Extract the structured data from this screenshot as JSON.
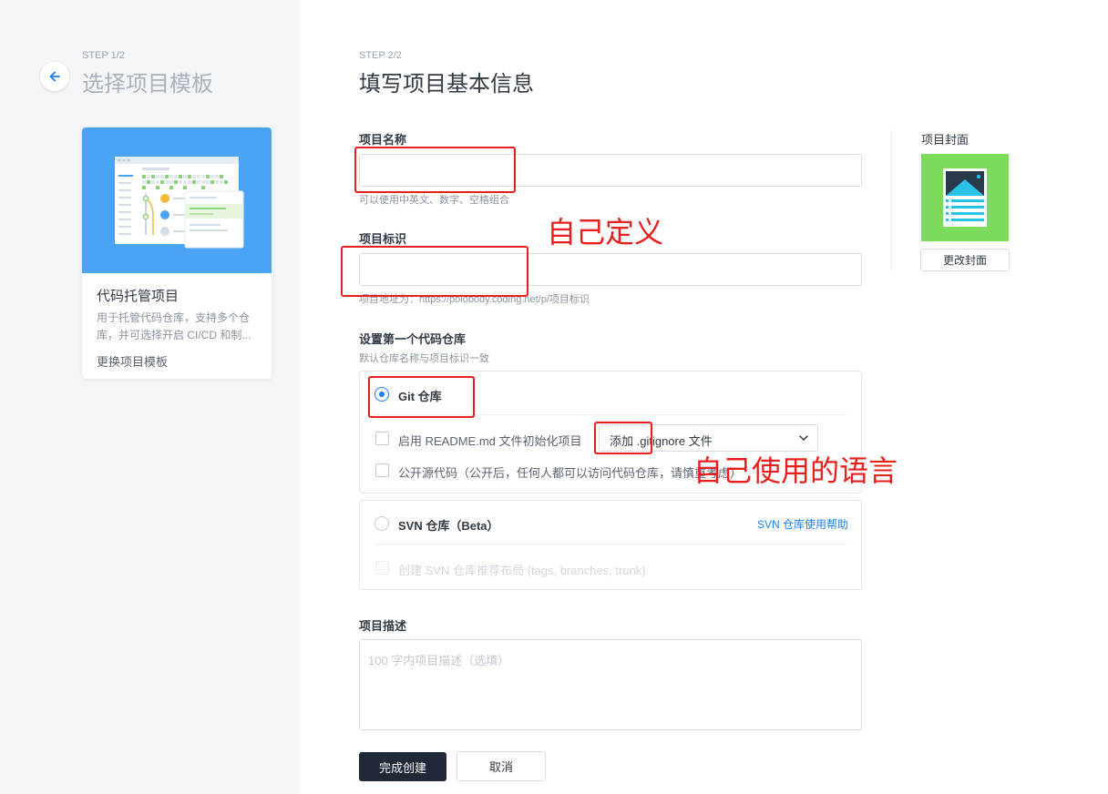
{
  "left_panel": {
    "step_label": "STEP 1/2",
    "title": "选择项目模板",
    "template": {
      "name": "代码托管项目",
      "description": "用于托管代码仓库，支持多个仓库，并可选择开启 CI/CD 和制...",
      "change_link": "更换项目模板"
    }
  },
  "main": {
    "step_label": "STEP 2/2",
    "title": "填写项目基本信息",
    "project_name": {
      "label": "项目名称",
      "value": "",
      "hint": "可以使用中英文、数字、空格组合"
    },
    "project_id": {
      "label": "项目标识",
      "value": "",
      "hint": "项目地址为：https://polobody.coding.net/p/项目标识"
    },
    "repo_section": {
      "label": "设置第一个代码仓库",
      "hint": "默认仓库名称与项目标识一致",
      "git": {
        "title": "Git 仓库",
        "selected": true,
        "readme_option": "启用 README.md 文件初始化项目",
        "gitignore_select": "添加 .gitignore 文件",
        "public_option": "公开源代码（公开后，任何人都可以访问代码仓库，请慎重考虑）"
      },
      "svn": {
        "title": "SVN 仓库（Beta）",
        "selected": false,
        "help_link": "SVN 仓库使用帮助",
        "layout_option": "创建 SVN 仓库推荐布局 (tags, branches, trunk)"
      }
    },
    "description": {
      "label": "项目描述",
      "placeholder": "100 字内项目描述（选填）"
    },
    "buttons": {
      "submit": "完成创建",
      "cancel": "取消"
    }
  },
  "cover": {
    "label": "项目封面",
    "change_button": "更改封面",
    "color": "#7ddb5c"
  },
  "annotations": {
    "note_define": "自己定义",
    "note_language": "自己使用的语言",
    "color": "#e8201d"
  }
}
